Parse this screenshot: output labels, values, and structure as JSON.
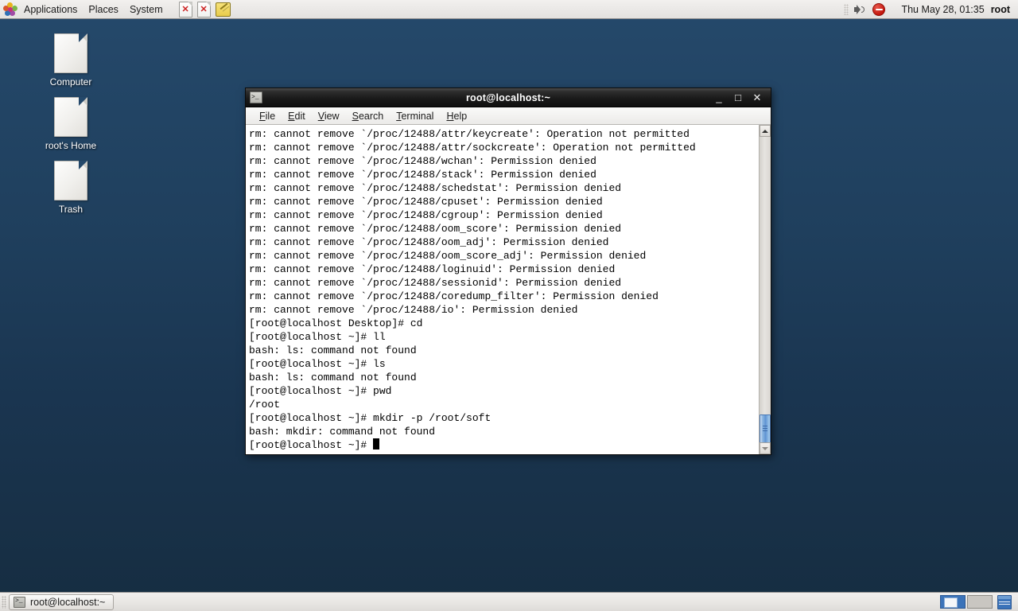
{
  "top_panel": {
    "apps_icon": "fedora-flower-icon",
    "menus": [
      "Applications",
      "Places",
      "System"
    ],
    "launchers": [
      {
        "name": "document-x-launcher-1",
        "icon": "document-with-red-x-icon"
      },
      {
        "name": "document-x-launcher-2",
        "icon": "document-with-red-x-icon"
      },
      {
        "name": "text-editor-launcher",
        "icon": "notepad-pencil-icon"
      }
    ],
    "tray": {
      "volume_icon": "speaker-icon",
      "blocked_icon": "no-entry-icon"
    },
    "clock": "Thu May 28, 01:35",
    "user": "root"
  },
  "desktop": {
    "icons": [
      {
        "label": "Computer",
        "icon": "document-icon"
      },
      {
        "label": "root's Home",
        "icon": "document-icon"
      },
      {
        "label": "Trash",
        "icon": "document-icon"
      }
    ]
  },
  "terminal": {
    "title": "root@localhost:~",
    "title_icon": "terminal-icon",
    "window_buttons": {
      "minimize": "_",
      "maximize": "□",
      "close": "✕"
    },
    "menu": [
      {
        "label": "File",
        "mnemonic": "F",
        "rest": "ile"
      },
      {
        "label": "Edit",
        "mnemonic": "E",
        "rest": "dit"
      },
      {
        "label": "View",
        "mnemonic": "V",
        "rest": "iew"
      },
      {
        "label": "Search",
        "mnemonic": "S",
        "rest": "earch"
      },
      {
        "label": "Terminal",
        "mnemonic": "T",
        "rest": "erminal"
      },
      {
        "label": "Help",
        "mnemonic": "H",
        "rest": "elp"
      }
    ],
    "output": "rm: cannot remove `/proc/12488/attr/keycreate': Operation not permitted\nrm: cannot remove `/proc/12488/attr/sockcreate': Operation not permitted\nrm: cannot remove `/proc/12488/wchan': Permission denied\nrm: cannot remove `/proc/12488/stack': Permission denied\nrm: cannot remove `/proc/12488/schedstat': Permission denied\nrm: cannot remove `/proc/12488/cpuset': Permission denied\nrm: cannot remove `/proc/12488/cgroup': Permission denied\nrm: cannot remove `/proc/12488/oom_score': Permission denied\nrm: cannot remove `/proc/12488/oom_adj': Permission denied\nrm: cannot remove `/proc/12488/oom_score_adj': Permission denied\nrm: cannot remove `/proc/12488/loginuid': Permission denied\nrm: cannot remove `/proc/12488/sessionid': Permission denied\nrm: cannot remove `/proc/12488/coredump_filter': Permission denied\nrm: cannot remove `/proc/12488/io': Permission denied\n[root@localhost Desktop]# cd\n[root@localhost ~]# ll\nbash: ls: command not found\n[root@localhost ~]# ls\nbash: ls: command not found\n[root@localhost ~]# pwd\n/root\n[root@localhost ~]# mkdir -p /root/soft\nbash: mkdir: command not found\n",
    "prompt": "[root@localhost ~]# "
  },
  "bottom_panel": {
    "task_button": {
      "label": "root@localhost:~",
      "icon": "terminal-icon"
    },
    "workspaces": [
      {
        "name": "workspace-1",
        "active": true
      },
      {
        "name": "workspace-2",
        "active": false
      }
    ],
    "show_desktop": "show-desktop-icon"
  }
}
